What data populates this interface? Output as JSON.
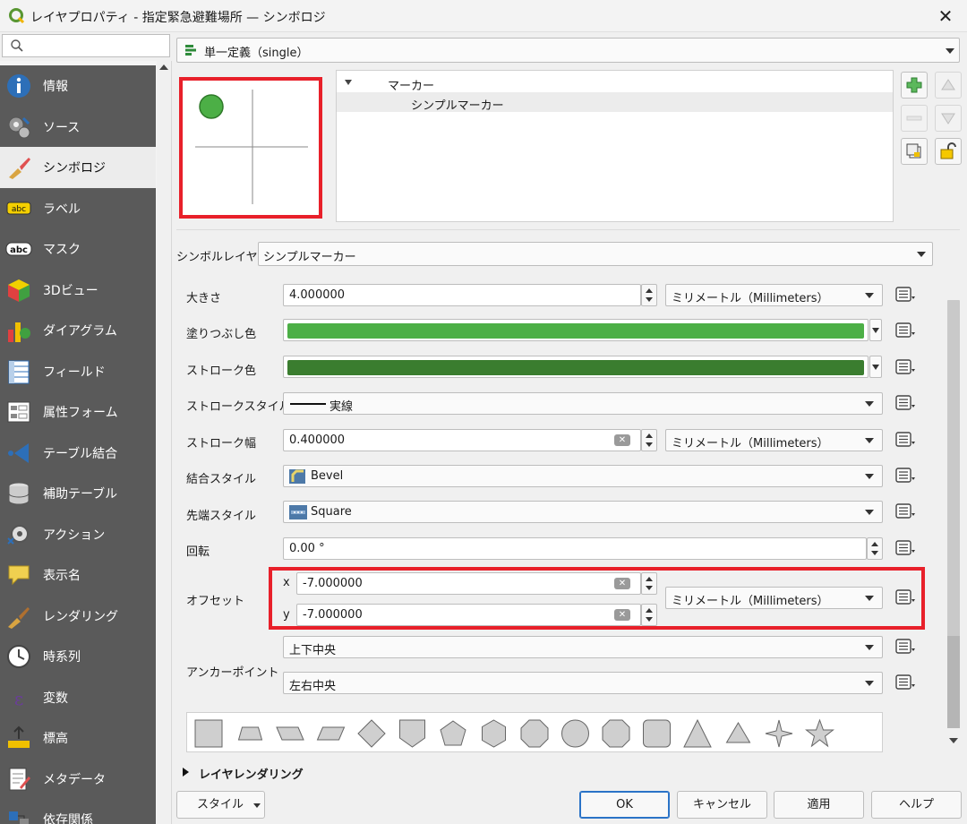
{
  "window": {
    "title": "レイヤプロパティ - 指定緊急避難場所 — シンボロジ",
    "close_glyph": "✕"
  },
  "sidebar": {
    "search_placeholder": "",
    "items": [
      {
        "label": "情報",
        "icon": "info-icon"
      },
      {
        "label": "ソース",
        "icon": "source-icon"
      },
      {
        "label": "シンボロジ",
        "icon": "symbology-icon",
        "active": true
      },
      {
        "label": "ラベル",
        "icon": "label-icon"
      },
      {
        "label": "マスク",
        "icon": "mask-icon"
      },
      {
        "label": "3Dビュー",
        "icon": "3d-view-icon"
      },
      {
        "label": "ダイアグラム",
        "icon": "diagram-icon"
      },
      {
        "label": "フィールド",
        "icon": "fields-icon"
      },
      {
        "label": "属性フォーム",
        "icon": "attributes-form-icon"
      },
      {
        "label": "テーブル結合",
        "icon": "joins-icon"
      },
      {
        "label": "補助テーブル",
        "icon": "auxiliary-storage-icon"
      },
      {
        "label": "アクション",
        "icon": "actions-icon"
      },
      {
        "label": "表示名",
        "icon": "display-icon"
      },
      {
        "label": "レンダリング",
        "icon": "rendering-icon"
      },
      {
        "label": "時系列",
        "icon": "temporal-icon"
      },
      {
        "label": "変数",
        "icon": "variables-icon"
      },
      {
        "label": "標高",
        "icon": "elevation-icon"
      },
      {
        "label": "メタデータ",
        "icon": "metadata-icon"
      },
      {
        "label": "依存関係",
        "icon": "dependencies-icon"
      }
    ]
  },
  "renderer": {
    "type_label": "単一定義（single）"
  },
  "symbol_tree": {
    "root": "マーカー",
    "child": "シンプルマーカー"
  },
  "symbol_layer": {
    "type_label": "シンボルレイヤ型",
    "type_value": "シンプルマーカー"
  },
  "properties": {
    "size": {
      "label": "大きさ",
      "value": "4.000000",
      "unit": "ミリメートル（Millimeters）"
    },
    "fill_color": {
      "label": "塗りつぶし色",
      "color": "#4caf46"
    },
    "stroke_color": {
      "label": "ストローク色",
      "color": "#3a7d2f"
    },
    "stroke_style": {
      "label": "ストロークスタイル",
      "value": "実線"
    },
    "stroke_width": {
      "label": "ストローク幅",
      "value": "0.400000",
      "unit": "ミリメートル（Millimeters）"
    },
    "join_style": {
      "label": "結合スタイル",
      "value": "Bevel"
    },
    "cap_style": {
      "label": "先端スタイル",
      "value": "Square"
    },
    "rotation": {
      "label": "回転",
      "value": "0.00 °"
    },
    "offset": {
      "label": "オフセット",
      "x_label": "x",
      "x_value": "-7.000000",
      "y_label": "y",
      "y_value": "-7.000000",
      "unit": "ミリメートル（Millimeters）"
    },
    "anchor": {
      "label": "アンカーポイント",
      "vertical": "上下中央",
      "horizontal": "左右中央"
    }
  },
  "shapes": [
    "square",
    "trapezoid",
    "parallelogram-left",
    "parallelogram-right",
    "diamond",
    "shield",
    "pentagon",
    "hexagon",
    "octagon",
    "decagon",
    "rounded-octagon",
    "rounded-square",
    "triangle",
    "equilateral-triangle",
    "4-point-star",
    "star"
  ],
  "layer_rendering": {
    "label": "レイヤレンダリング"
  },
  "buttons": {
    "style": "スタイル",
    "ok": "OK",
    "cancel": "キャンセル",
    "apply": "適用",
    "help": "ヘルプ"
  },
  "colors": {
    "accent_red": "#e8202a",
    "sidebar_bg": "#5a5a5a",
    "marker_green": "#4caf46"
  }
}
